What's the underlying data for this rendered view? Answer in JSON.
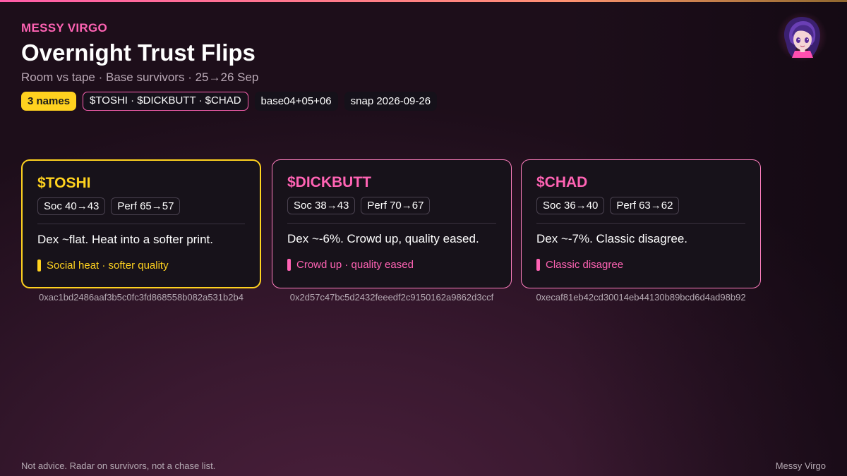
{
  "header": {
    "brand": "MESSY VIRGO",
    "title": "Overnight Trust Flips",
    "subtitle": "Room vs tape · Base survivors · 25→26 Sep"
  },
  "chips": [
    "3 names",
    "$TOSHI · $DICKBUTT · $CHAD",
    "base04+05+06",
    "snap 2026-09-26"
  ],
  "colors": {
    "accent_pink": "#ff63b4",
    "accent_gold": "#ffd21f",
    "card_bg": "#17121a"
  },
  "avatar": {
    "icon": "anime-avatar-icon"
  },
  "cards": [
    {
      "ticker": "$TOSHI",
      "soc": "Soc 40→43",
      "perf": "Perf 65→57",
      "note": "Dex ~flat. Heat into a softer print.",
      "tag": "Social heat · softer quality",
      "address": "0xac1bd2486aaf3b5c0fc3fd868558b082a531b2b4"
    },
    {
      "ticker": "$DICKBUTT",
      "soc": "Soc 38→43",
      "perf": "Perf 70→67",
      "note": "Dex ~-6%. Crowd up, quality eased.",
      "tag": "Crowd up · quality eased",
      "address": "0x2d57c47bc5d2432feeedf2c9150162a9862d3ccf"
    },
    {
      "ticker": "$CHAD",
      "soc": "Soc 36→40",
      "perf": "Perf 63→62",
      "note": "Dex ~-7%. Classic disagree.",
      "tag": "Classic disagree",
      "address": "0xecaf81eb42cd30014eb44130b89bcd6d4ad98b92"
    }
  ],
  "footer": {
    "left": "Not advice. Radar on survivors, not a chase list.",
    "right": "Messy Virgo"
  }
}
